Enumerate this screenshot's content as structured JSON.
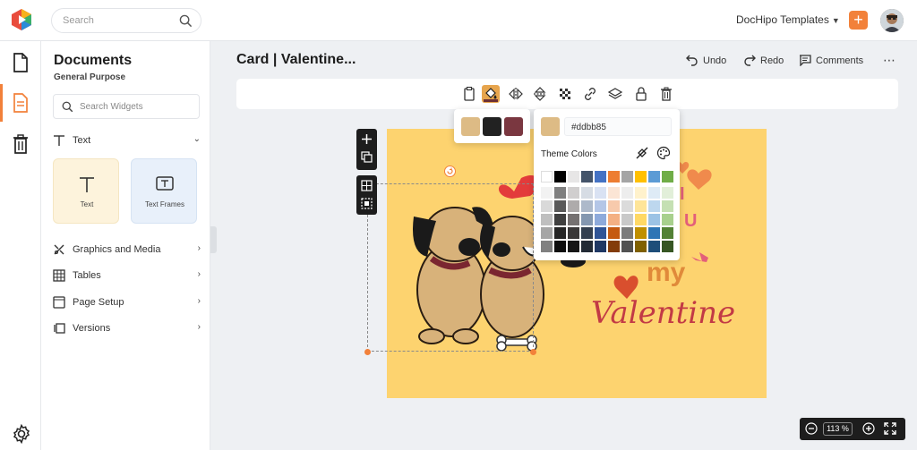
{
  "topbar": {
    "search_placeholder": "Search",
    "templates_label": "DocHipo Templates",
    "add_label": "+"
  },
  "panel": {
    "title": "Documents",
    "subtitle": "General Purpose",
    "widget_search_placeholder": "Search Widgets",
    "text_section": "Text",
    "tiles": [
      "Text",
      "Text Frames"
    ],
    "sections": [
      "Graphics and Media",
      "Tables",
      "Page Setup",
      "Versions"
    ]
  },
  "header": {
    "title": "Card | Valentine...",
    "undo": "Undo",
    "redo": "Redo",
    "comments": "Comments"
  },
  "card": {
    "word_my": "my",
    "word_valentine": "Valentine",
    "letter_i": "I",
    "letter_u": "U"
  },
  "color_picker": {
    "recent_swatches": [
      "#ddbb85",
      "#222222",
      "#7a3740"
    ],
    "current": "#ddbb85",
    "hex_value": "#ddbb85",
    "theme_label": "Theme Colors",
    "theme_top": [
      "#ffffff",
      "#000000",
      "#e7e6e6",
      "#44546a",
      "#4472c4",
      "#ed7d31",
      "#a5a5a5",
      "#ffc000",
      "#5b9bd5",
      "#70ad47"
    ],
    "theme_cols": [
      [
        "#f2f2f2",
        "#d9d9d9",
        "#bfbfbf",
        "#a6a6a6",
        "#808080"
      ],
      [
        "#7f7f7f",
        "#595959",
        "#404040",
        "#262626",
        "#0d0d0d"
      ],
      [
        "#d0cece",
        "#aeabab",
        "#757171",
        "#3a3838",
        "#161616"
      ],
      [
        "#d6dce4",
        "#adb9ca",
        "#8497b0",
        "#333f4f",
        "#222a35"
      ],
      [
        "#d9e2f3",
        "#b4c6e7",
        "#8eaadb",
        "#2f5496",
        "#1f3864"
      ],
      [
        "#fbe5d5",
        "#f7caac",
        "#f4b083",
        "#c55a11",
        "#833c0b"
      ],
      [
        "#ededed",
        "#dbdbdb",
        "#c9c9c9",
        "#7b7b7b",
        "#525252"
      ],
      [
        "#fff2cc",
        "#fee599",
        "#ffd965",
        "#bf8f00",
        "#7f6000"
      ],
      [
        "#deebf6",
        "#bdd7ee",
        "#9cc3e5",
        "#2e75b5",
        "#1e4e79"
      ],
      [
        "#e2efd9",
        "#c5e0b3",
        "#a8d08d",
        "#538135",
        "#375623"
      ]
    ]
  },
  "zoom": {
    "value": "113 %"
  },
  "colors": {
    "accent": "#f2813a",
    "card_bg": "#fdd36f",
    "dark": "#1d1d1d"
  }
}
